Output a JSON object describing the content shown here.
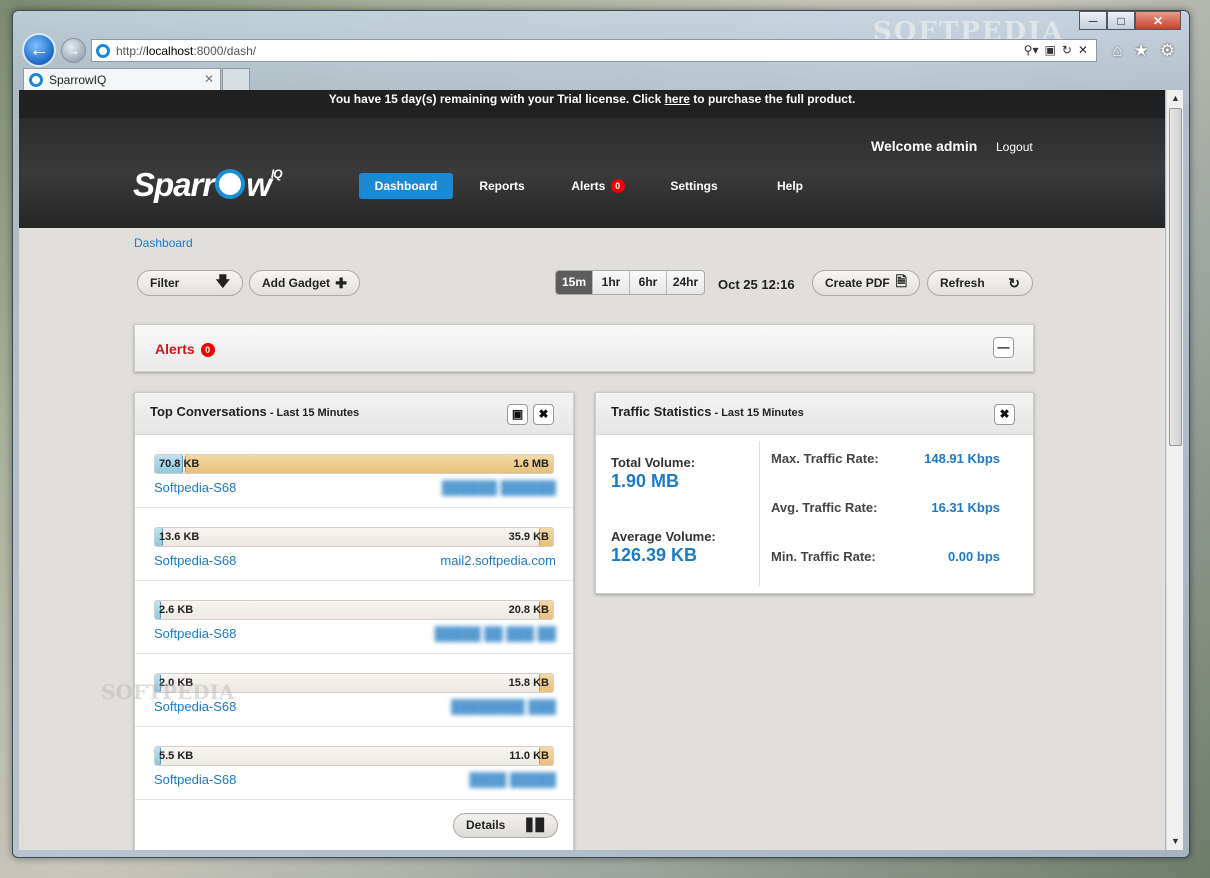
{
  "browser": {
    "url_prefix": "http://",
    "url_host": "localhost",
    "url_rest": ":8000/dash/",
    "tab_title": "SparrowIQ",
    "watermark": "SOFTPEDIA",
    "minimize": "─",
    "maximize": "□",
    "close": "✕",
    "search_icon": "search-icon",
    "home_icon": "home-icon",
    "favorites_icon": "star-icon",
    "tools_icon": "gear-icon"
  },
  "trial": {
    "text_before": "You have 15 day(s) remaining with your Trial license. Click ",
    "link": "here",
    "text_after": " to purchase the full product."
  },
  "header": {
    "welcome": "Welcome admin",
    "logout": "Logout",
    "logo_left": "Sparr",
    "logo_right": "w",
    "logo_sup": "IQ",
    "nav": {
      "dashboard": "Dashboard",
      "reports": "Reports",
      "alerts": "Alerts",
      "alerts_count": "0",
      "settings": "Settings",
      "help": "Help"
    }
  },
  "breadcrumb": "Dashboard",
  "toolbar": {
    "filter": "Filter",
    "add_gadget": "Add Gadget",
    "ranges": [
      "15m",
      "1hr",
      "6hr",
      "24hr"
    ],
    "active_range": "15m",
    "timestamp": "Oct 25 12:16",
    "create_pdf": "Create PDF",
    "refresh": "Refresh"
  },
  "alerts_panel": {
    "title": "Alerts",
    "count": "0"
  },
  "top_conversations": {
    "title": "Top Conversations",
    "subtitle": " - Last 15 Minutes",
    "rows": [
      {
        "in": "70.8 KB",
        "out": "1.6 MB",
        "in_frac": 0.07,
        "out_frac": 0.92,
        "src": "Softpedia-S68",
        "dst": "██████ ██████",
        "dst_blurred": true
      },
      {
        "in": "13.6 KB",
        "out": "35.9 KB",
        "in_frac": 0.02,
        "out_frac": 0.03,
        "src": "Softpedia-S68",
        "dst": "mail2.softpedia.com",
        "dst_blurred": false
      },
      {
        "in": "2.6 KB",
        "out": "20.8 KB",
        "in_frac": 0.01,
        "out_frac": 0.03,
        "src": "Softpedia-S68",
        "dst": "█████ ██ ███ ██",
        "dst_blurred": true
      },
      {
        "in": "2.0 KB",
        "out": "15.8 KB",
        "in_frac": 0.01,
        "out_frac": 0.03,
        "src": "Softpedia-S68",
        "dst": "████████ ███",
        "dst_blurred": true
      },
      {
        "in": "5.5 KB",
        "out": "11.0 KB",
        "in_frac": 0.01,
        "out_frac": 0.03,
        "src": "Softpedia-S68",
        "dst": "████ █████",
        "dst_blurred": true
      }
    ],
    "details": "Details"
  },
  "traffic_statistics": {
    "title": "Traffic Statistics",
    "subtitle": " - Last 15 Minutes",
    "total_volume_label": "Total Volume:",
    "total_volume": "1.90 MB",
    "average_volume_label": "Average Volume:",
    "average_volume": "126.39 KB",
    "max_rate_label": "Max. Traffic Rate:",
    "max_rate": "148.91 Kbps",
    "avg_rate_label": "Avg. Traffic Rate:",
    "avg_rate": "16.31 Kbps",
    "min_rate_label": "Min. Traffic Rate:",
    "min_rate": "0.00 bps"
  },
  "colors": {
    "accent": "#1a8ad4",
    "link": "#1e7ac2",
    "alert_red": "#d0161a",
    "header_bg": "#2c2c2c"
  }
}
